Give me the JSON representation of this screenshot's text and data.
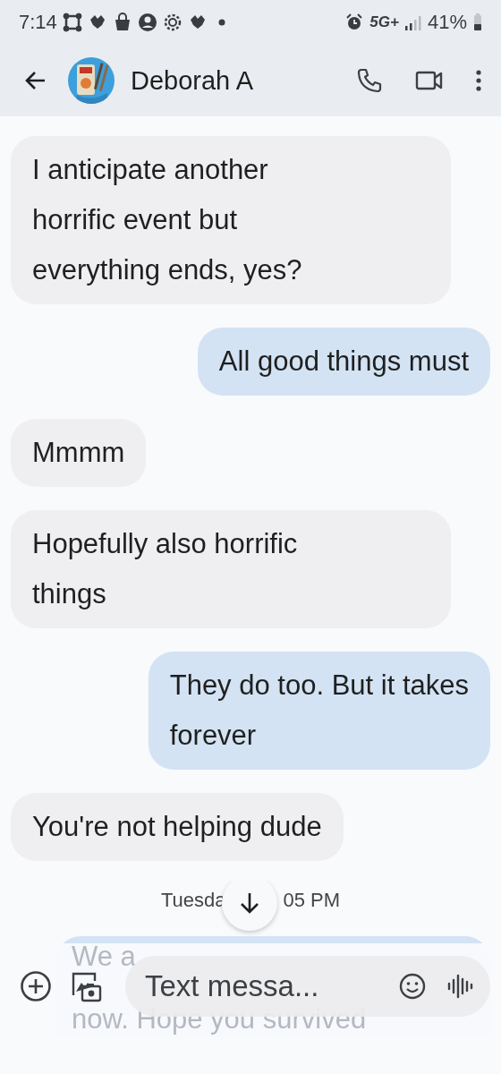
{
  "status_bar": {
    "time": "7:14",
    "network": "5G+",
    "battery": "41%"
  },
  "header": {
    "contact": "Deborah A"
  },
  "messages": [
    {
      "kind": "incoming",
      "lines": [
        "I anticipate another",
        "horrific event but",
        "everything ends, yes?"
      ]
    },
    {
      "kind": "outgoing",
      "lines": [
        "All good things must"
      ]
    },
    {
      "kind": "incoming",
      "lines": [
        "Mmmm"
      ]
    },
    {
      "kind": "incoming",
      "lines": [
        "Hopefully also horrific",
        "things"
      ]
    },
    {
      "kind": "outgoing",
      "lines": [
        "They do too. But it takes",
        "forever"
      ]
    },
    {
      "kind": "incoming",
      "lines": [
        "You're not helping dude"
      ]
    }
  ],
  "date_divider": {
    "left_part": "Tuesda",
    "right_part": "05 PM"
  },
  "partial_message": {
    "lines": [
      "We a",
      "now. Hope you survived"
    ]
  },
  "composer": {
    "placeholder": "Text messa..."
  }
}
